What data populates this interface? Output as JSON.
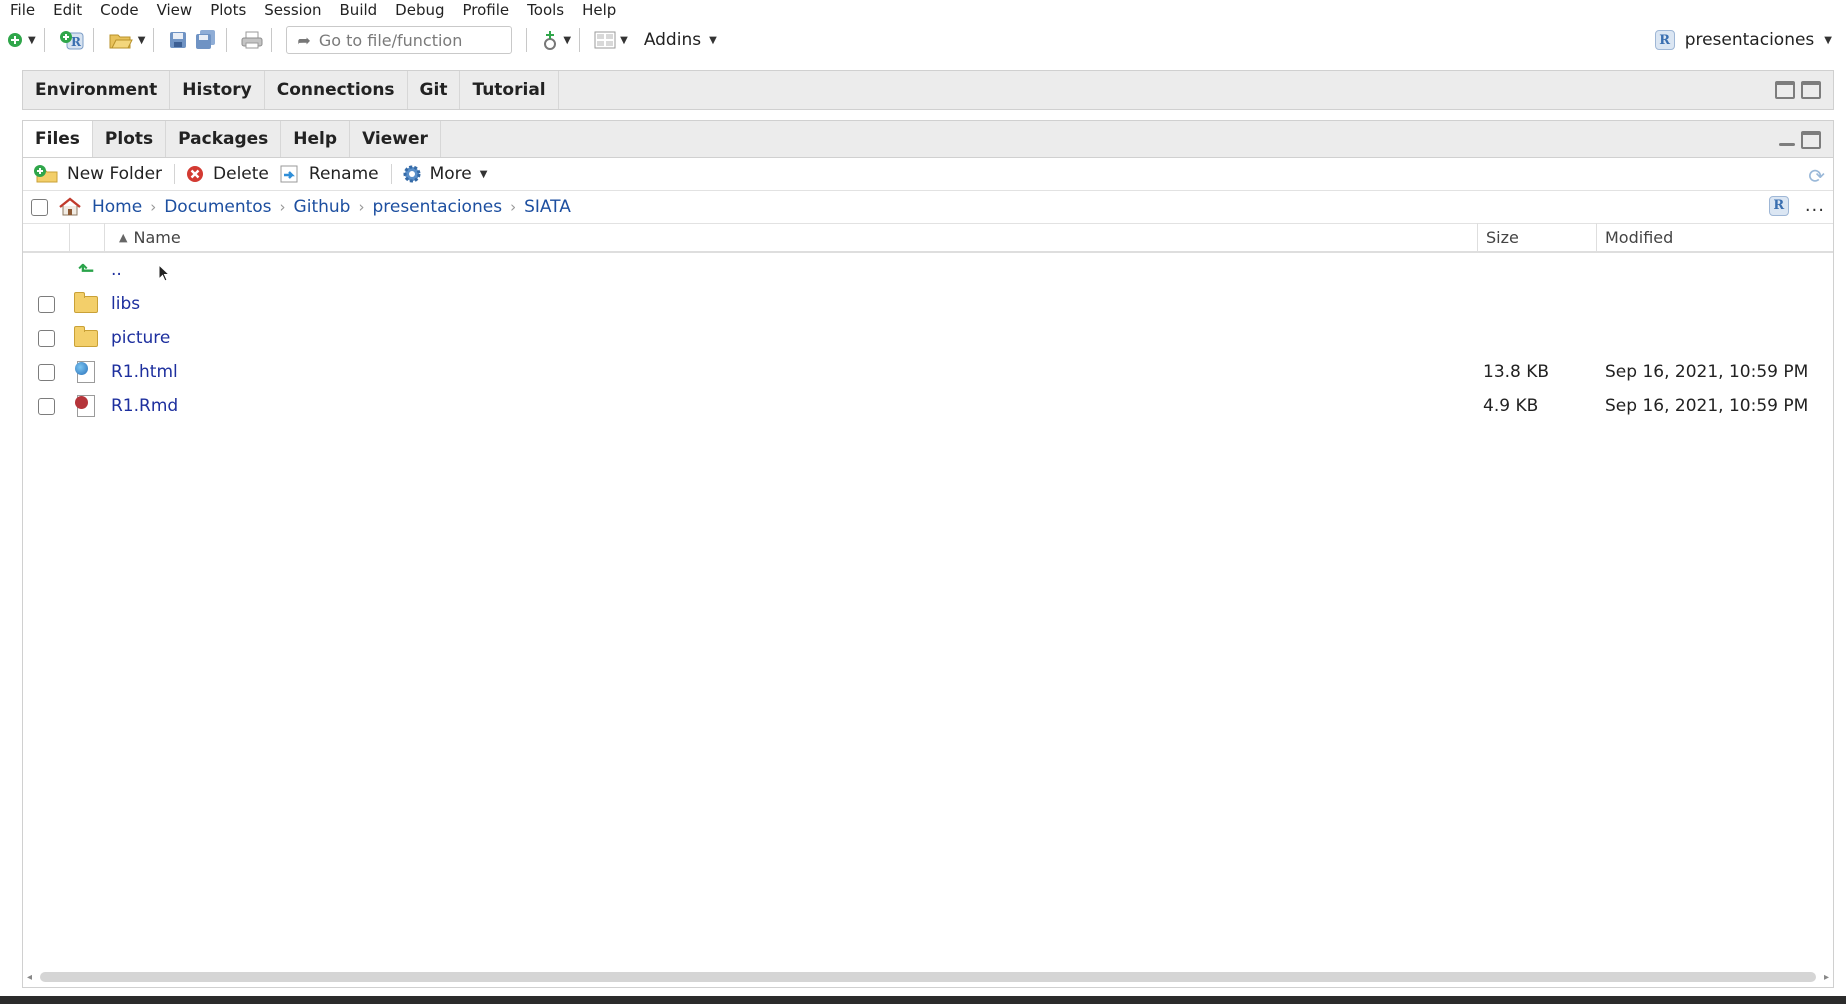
{
  "menu": {
    "items": [
      "File",
      "Edit",
      "Code",
      "View",
      "Plots",
      "Session",
      "Build",
      "Debug",
      "Profile",
      "Tools",
      "Help"
    ]
  },
  "toolbar": {
    "goto_placeholder": "Go to file/function",
    "addins_label": "Addins",
    "project_label": "presentaciones"
  },
  "top_pane": {
    "tabs": [
      "Environment",
      "History",
      "Connections",
      "Git",
      "Tutorial"
    ]
  },
  "files_pane": {
    "tabs": [
      "Files",
      "Plots",
      "Packages",
      "Help",
      "Viewer"
    ],
    "active_tab": "Files",
    "actions": {
      "new_folder": "New Folder",
      "delete": "Delete",
      "rename": "Rename",
      "more": "More"
    },
    "breadcrumb": [
      "Home",
      "Documentos",
      "Github",
      "presentaciones",
      "SIATA"
    ],
    "more_label": "...",
    "columns": {
      "name": "Name",
      "size": "Size",
      "modified": "Modified"
    },
    "parent_label": "..",
    "rows": [
      {
        "name": "libs",
        "type": "folder",
        "size": "",
        "modified": ""
      },
      {
        "name": "picture",
        "type": "folder",
        "size": "",
        "modified": ""
      },
      {
        "name": "R1.html",
        "type": "html",
        "size": "13.8 KB",
        "modified": "Sep 16, 2021, 10:59 PM"
      },
      {
        "name": "R1.Rmd",
        "type": "rmd",
        "size": "4.9 KB",
        "modified": "Sep 16, 2021, 10:59 PM"
      }
    ]
  },
  "colors": {
    "link": "#1d2f9e",
    "breadcrumb_link": "#1d4fa0",
    "tab_bg": "#ececec",
    "folder": "#f3cf6a"
  }
}
